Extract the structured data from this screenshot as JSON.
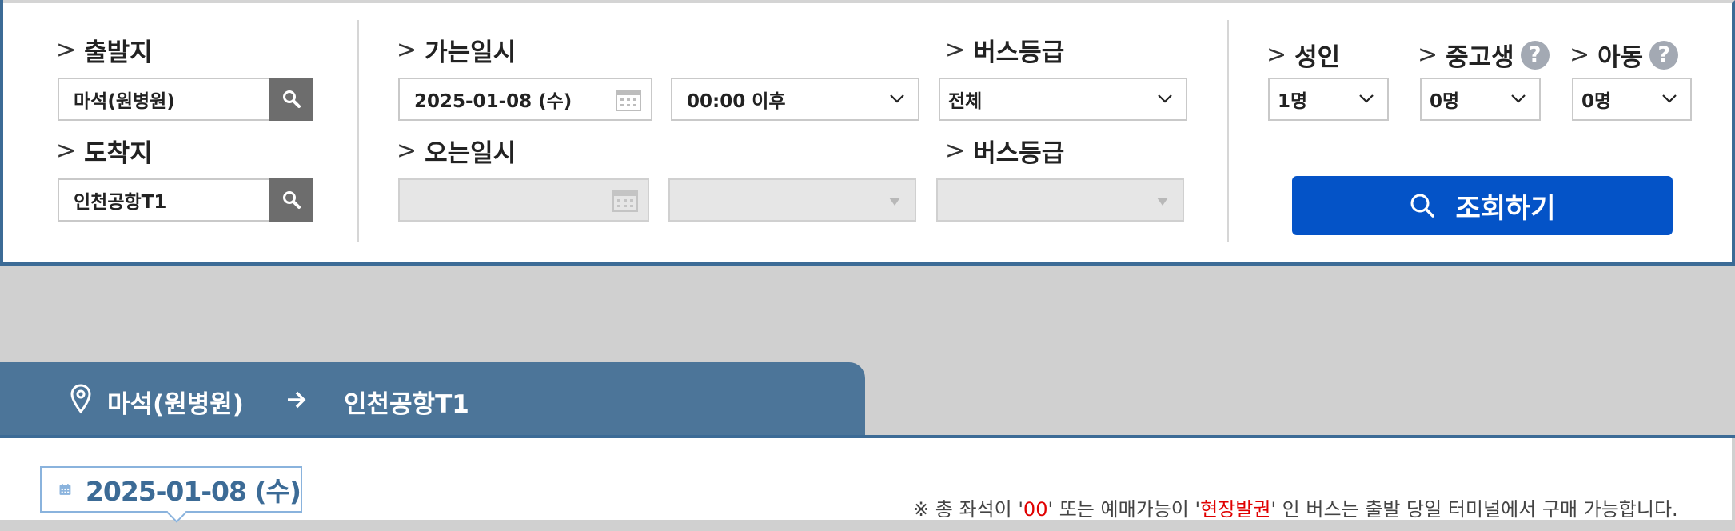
{
  "search": {
    "departure": {
      "label": "출발지",
      "value": "마석(원병원)"
    },
    "arrival": {
      "label": "도착지",
      "value": "인천공항T1"
    },
    "go_date": {
      "label": "가는일시",
      "date": "2025-01-08 (수)",
      "time": "00:00 이후"
    },
    "go_grade": {
      "label": "버스등급",
      "value": "전체"
    },
    "return_date": {
      "label": "오는일시",
      "date": "",
      "time": ""
    },
    "return_grade": {
      "label": "버스등급",
      "value": ""
    },
    "adult": {
      "label": "성인",
      "value": "1명"
    },
    "student": {
      "label": "중고생",
      "value": "0명"
    },
    "child": {
      "label": "아동",
      "value": "0명"
    },
    "submit_label": "조회하기",
    "help_glyph": "?"
  },
  "route": {
    "from": "마석(원병원)",
    "to": "인천공항T1"
  },
  "selected_date": "2025-01-08 (수)",
  "notice": {
    "prefix": "※ 총 좌석이 '",
    "highlight1": "00",
    "middle": "' 또는 예매가능이 '",
    "highlight2": "현장발권",
    "suffix": "' 인 버스는 출발 당일 터미널에서 구매 가능합니다."
  },
  "colors": {
    "primary": "#0453c7",
    "route_bar": "#4c7599",
    "accent_border": "#3c6b96",
    "highlight": "#e00000"
  }
}
